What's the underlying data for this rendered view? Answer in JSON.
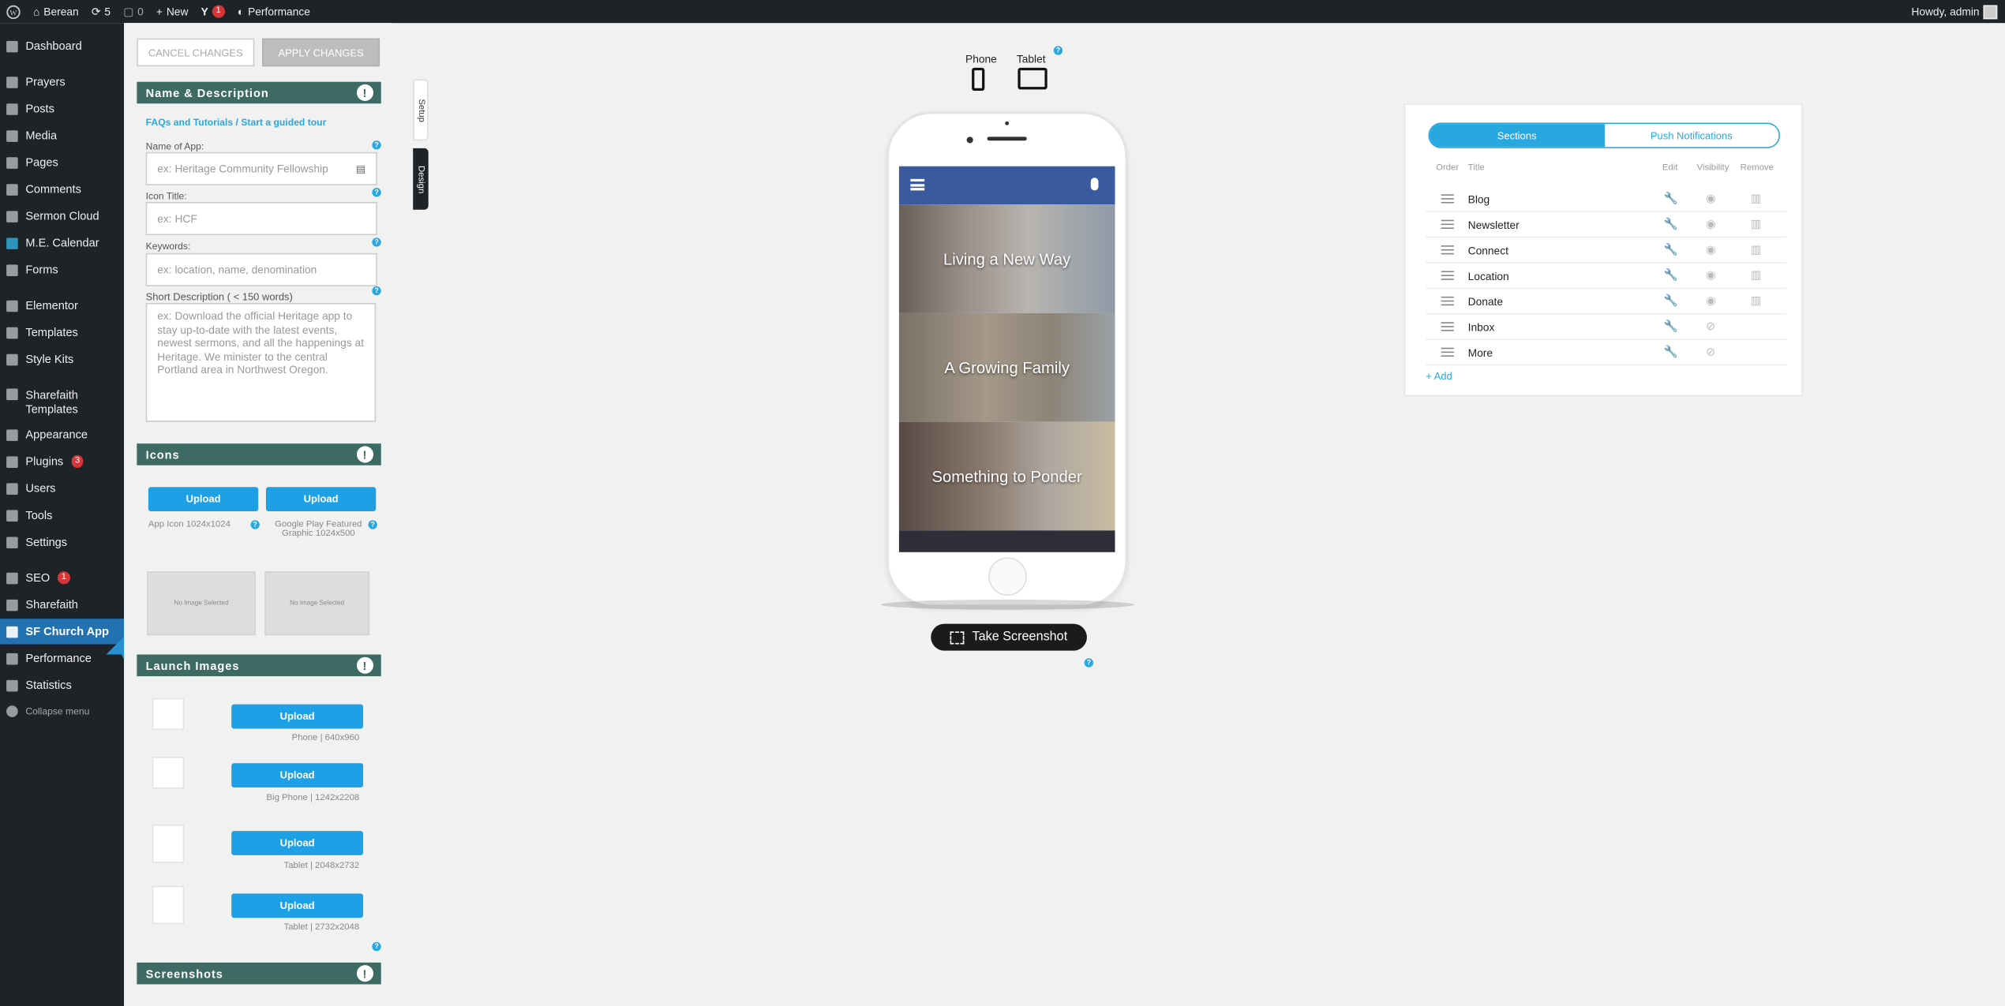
{
  "adminbar": {
    "site_name": "Berean",
    "updates_count": "5",
    "comments_count": "0",
    "new_label": "New",
    "yoast_count": "1",
    "performance_label": "Performance",
    "howdy": "Howdy, admin"
  },
  "sidebar": {
    "items": [
      {
        "label": "Dashboard",
        "icon": "dashboard-icon"
      },
      {
        "label": "Prayers",
        "icon": "pin-icon"
      },
      {
        "label": "Posts",
        "icon": "pin-icon"
      },
      {
        "label": "Media",
        "icon": "media-icon"
      },
      {
        "label": "Pages",
        "icon": "pages-icon"
      },
      {
        "label": "Comments",
        "icon": "comments-icon"
      },
      {
        "label": "Sermon Cloud",
        "icon": "cloud-icon"
      },
      {
        "label": "M.E. Calendar",
        "icon": "calendar-icon"
      },
      {
        "label": "Forms",
        "icon": "forms-icon"
      },
      {
        "label": "Elementor",
        "icon": "elementor-icon"
      },
      {
        "label": "Templates",
        "icon": "templates-icon"
      },
      {
        "label": "Style Kits",
        "icon": "stylekits-icon"
      },
      {
        "label": "Sharefaith Templates",
        "icon": "sharefaith-icon"
      },
      {
        "label": "Appearance",
        "icon": "appearance-icon"
      },
      {
        "label": "Plugins",
        "icon": "plugins-icon",
        "count": "3"
      },
      {
        "label": "Users",
        "icon": "users-icon"
      },
      {
        "label": "Tools",
        "icon": "tools-icon"
      },
      {
        "label": "Settings",
        "icon": "settings-icon"
      },
      {
        "label": "SEO",
        "icon": "seo-icon",
        "count": "1"
      },
      {
        "label": "Sharefaith",
        "icon": "sharefaith-icon"
      },
      {
        "label": "SF Church App",
        "icon": "phone-icon"
      },
      {
        "label": "Performance",
        "icon": "performance-icon"
      },
      {
        "label": "Statistics",
        "icon": "statistics-icon"
      },
      {
        "label": "Collapse menu",
        "icon": "collapse-icon"
      }
    ]
  },
  "panel": {
    "cancel_label": "CANCEL CHANGES",
    "apply_label": "APPLY CHANGES",
    "name_section": "Name & Description",
    "faq_link": "FAQs and Tutorials",
    "tour_link": "Start a guided tour",
    "link_sep": "/",
    "name_label": "Name of App:",
    "name_placeholder": "ex: Heritage Community Fellowship",
    "icon_title_label": "Icon Title:",
    "icon_title_placeholder": "ex: HCF",
    "keywords_label": "Keywords:",
    "keywords_placeholder": "ex: location, name, denomination",
    "short_desc_label": "Short Description ( < 150 words)",
    "short_desc_placeholder": "ex: Download the official Heritage app to stay up-to-date with the latest events, newest sermons, and all the happenings at Heritage. We minister to the central Portland area in Northwest Oregon.",
    "icons_section": "Icons",
    "upload_label": "Upload",
    "app_icon_note": "App Icon 1024x1024",
    "google_play_note": "Google Play Featured Graphic 1024x500",
    "no_image": "No Image Selected",
    "launch_section": "Launch Images",
    "launch_phone": "Phone | 640x960",
    "launch_big_phone": "Big Phone | 1242x2208",
    "launch_tablet1": "Tablet | 2048x2732",
    "launch_tablet2": "Tablet | 2732x2048",
    "screenshots_section": "Screenshots",
    "exclaim": "!",
    "help": "?"
  },
  "tabs": {
    "setup": "Setup",
    "design": "Design"
  },
  "devices": {
    "phone": "Phone",
    "tablet": "Tablet"
  },
  "phone_screen": {
    "tiles": [
      "Living a New Way",
      "A Growing Family",
      "Something to Ponder"
    ]
  },
  "screenshot_button": "Take Screenshot",
  "card": {
    "tab_sections": "Sections",
    "tab_push": "Push Notifications",
    "col_order": "Order",
    "col_title": "Title",
    "col_edit": "Edit",
    "col_visibility": "Visibility",
    "col_remove": "Remove",
    "rows": [
      "Blog",
      "Newsletter",
      "Connect",
      "Location",
      "Donate",
      "Inbox",
      "More"
    ],
    "add_label": "+ Add"
  },
  "colors": {
    "accent": "#29a7df",
    "header_green": "#3d6b64",
    "wp_dark": "#1d2327",
    "wp_blue": "#2271b1",
    "app_bar": "#3a5aa0"
  }
}
